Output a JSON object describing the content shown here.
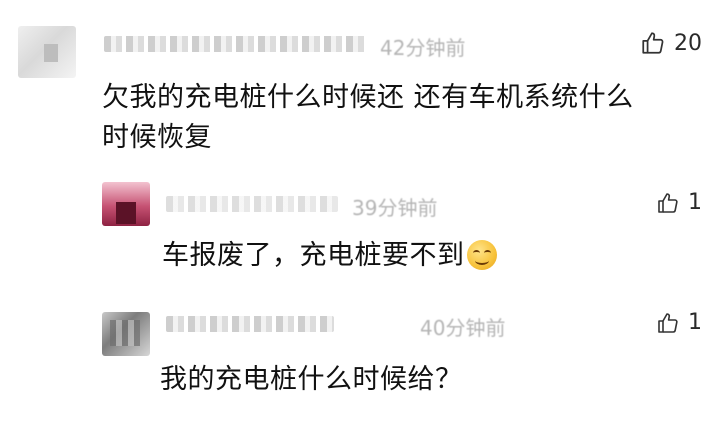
{
  "comments": [
    {
      "time": "42分钟前",
      "likes": "20",
      "text_line1": "欠我的充电桩什么时候还  还有车机系统什么",
      "text_line2": "时候恢复"
    },
    {
      "time": "39分钟前",
      "likes": "1",
      "text": "车报废了，充电桩要不到",
      "emoji": "laughing-face-emoji"
    },
    {
      "time": "40分钟前",
      "likes": "1",
      "text": "我的充电桩什么时候给？"
    }
  ],
  "icons": {
    "like": "thumbs-up-icon"
  }
}
